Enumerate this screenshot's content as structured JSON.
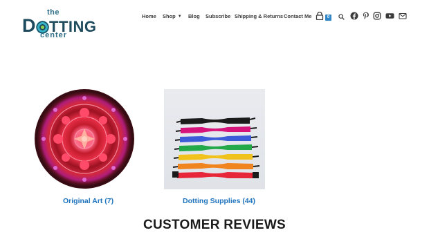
{
  "logo": {
    "the": "the",
    "main_prefix": "D",
    "main_suffix": "TTING",
    "center": "center"
  },
  "nav": {
    "items": [
      "Home",
      "Shop",
      "Blog",
      "Subscribe",
      "Shipping & Returns",
      "Contact Me"
    ]
  },
  "cart": {
    "count": "0"
  },
  "icons": [
    "cart-icon",
    "search-icon",
    "facebook-icon",
    "pinterest-icon",
    "instagram-icon",
    "youtube-icon",
    "email-icon"
  ],
  "categories": [
    {
      "title": "Original Art (7)",
      "image": "red-mandala-dot-art"
    },
    {
      "title": "Dotting Supplies (44)",
      "image": "rainbow-dotting-tools"
    }
  ],
  "reviews": {
    "title": "CUSTOMER REVIEWS"
  },
  "colors": {
    "link": "#1e73be",
    "brand_dark": "#1d4a5c",
    "brand_teal": "#2e6e86",
    "badge": "#2f86c8"
  }
}
